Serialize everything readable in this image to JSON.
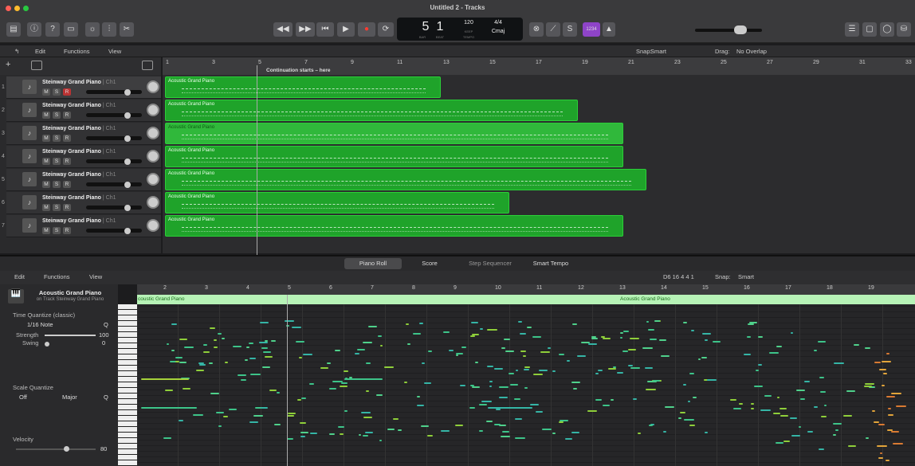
{
  "window": {
    "title": "Untitled 2 - Tracks"
  },
  "transport": {
    "bar": "5",
    "beat": "1",
    "bar_label": "BAR",
    "beat_label": "BEAT",
    "tempo": "120",
    "tempo_sub": "KEEP",
    "tempo_label": "TEMPO",
    "sig": "4/4",
    "key": "Cmaj",
    "count_in": "1234"
  },
  "tracks_toolbar": {
    "edit": "Edit",
    "functions": "Functions",
    "view": "View",
    "snap_label": "Snap:",
    "snap_value": "Smart",
    "drag_label": "Drag:",
    "drag_value": "No Overlap"
  },
  "ruler": {
    "marks": [
      "1",
      "3",
      "5",
      "7",
      "9",
      "11",
      "13",
      "15",
      "17",
      "19",
      "21",
      "23",
      "25",
      "27",
      "29",
      "31",
      "33"
    ],
    "marker": "Continuation starts – here"
  },
  "tracks": [
    {
      "num": "1",
      "name": "Steinway Grand Piano",
      "ch": "| Ch1",
      "m": "M",
      "s": "S",
      "r": "R"
    },
    {
      "num": "2",
      "name": "Steinway Grand Piano",
      "ch": "| Ch1",
      "m": "M",
      "s": "S",
      "r": "R"
    },
    {
      "num": "3",
      "name": "Steinway Grand Piano",
      "ch": "| Ch1",
      "m": "M",
      "s": "S",
      "r": "R"
    },
    {
      "num": "4",
      "name": "Steinway Grand Piano",
      "ch": "| Ch1",
      "m": "M",
      "s": "S",
      "r": "R"
    },
    {
      "num": "5",
      "name": "Steinway Grand Piano",
      "ch": "| Ch1",
      "m": "M",
      "s": "S",
      "r": "R"
    },
    {
      "num": "6",
      "name": "Steinway Grand Piano",
      "ch": "| Ch1",
      "m": "M",
      "s": "S",
      "r": "R"
    },
    {
      "num": "7",
      "name": "Steinway Grand Piano",
      "ch": "| Ch1",
      "m": "M",
      "s": "S",
      "r": "R"
    }
  ],
  "regions": {
    "label": "Acoustic Grand Piano"
  },
  "editor_tabs": [
    "Piano Roll",
    "Score",
    "Step Sequencer",
    "Smart Tempo"
  ],
  "pr_toolbar": {
    "edit": "Edit",
    "functions": "Functions",
    "view": "View",
    "position": "D6  16 4 4 1",
    "snap_label": "Snap:",
    "snap_value": "Smart"
  },
  "inspector": {
    "region_name": "Acoustic Grand Piano",
    "region_track": "on Track Steinway Grand Piano",
    "tq_title": "Time Quantize (classic)",
    "tq_value": "1/16 Note",
    "q": "Q",
    "strength_label": "Strength",
    "strength_value": "100",
    "swing_label": "Swing",
    "swing_value": "0",
    "sq_title": "Scale Quantize",
    "sq_off": "Off",
    "sq_scale": "Major",
    "vel_label": "Velocity",
    "vel_value": "80"
  },
  "pr_ruler": {
    "marks": [
      "2",
      "3",
      "4",
      "5",
      "6",
      "7",
      "8",
      "9",
      "10",
      "11",
      "12",
      "13",
      "14",
      "15",
      "16",
      "17",
      "18",
      "19"
    ]
  },
  "pr_regions": {
    "left": "coustic Grand Piano",
    "right": "Acoustic Grand Piano"
  }
}
